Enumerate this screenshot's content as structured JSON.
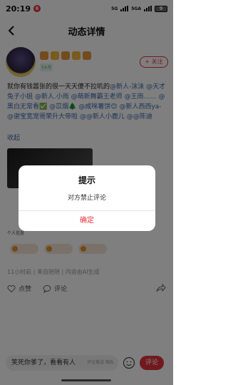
{
  "status_bar": {
    "time": "20:19",
    "app_badge": "6",
    "network_labels": [
      "5G",
      "5GA"
    ],
    "battery": "9"
  },
  "nav": {
    "title": "动态详情"
  },
  "author": {
    "level": "Lv.9",
    "follow_label": "+ 关注"
  },
  "post": {
    "text_lead": "就你有钱嚣张的很一天天傻不拉叽的",
    "mentions": [
      "@新人-沫沫",
      "@天才兔子小姐 ",
      "@新人.小雨",
      "@萌新舞霸王老师",
      "@王雨……",
      "@黑白无常看✅",
      "@苡烟🌲",
      "@咸咪薯饼😊",
      "@新人西西ya-",
      "@谢宝宽宠哥荣升大帝啦",
      "@@新人小鹿儿",
      "@@陈迪"
    ],
    "collapse_label": "收起",
    "image_caption": "个人信息",
    "meta": "11小时前 | 来自陪陪 | 内容由AI生成"
  },
  "actions": {
    "like_label": "点赞",
    "comment_label": "评论"
  },
  "comment_bar": {
    "input_value": "笑死你爹了，看看有人",
    "input_hint": "评论推送   隐私",
    "send_label": "评论"
  },
  "dialog": {
    "title": "提示",
    "message": "对方禁止评论",
    "confirm_label": "确定"
  },
  "colors": {
    "accent": "#e5323d",
    "mention": "#3a6ab0",
    "overlay": "rgba(0,0,0,0.5)"
  }
}
